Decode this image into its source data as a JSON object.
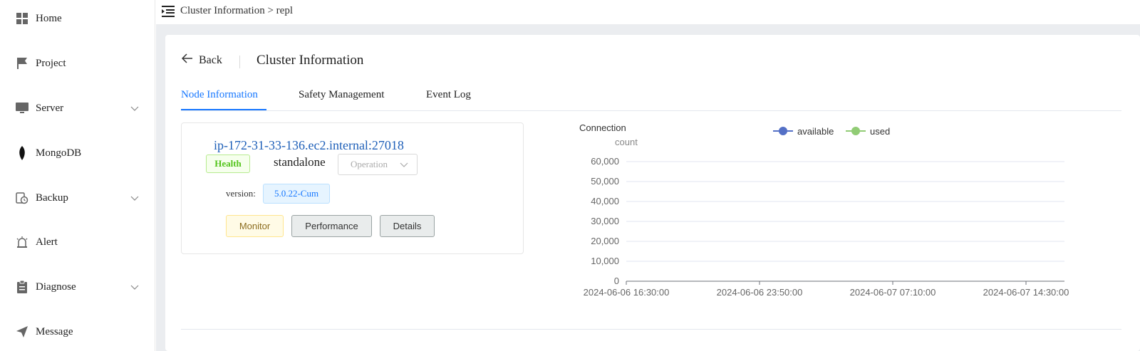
{
  "sidebar": {
    "items": [
      {
        "label": "Home",
        "icon": "grid-icon",
        "has_submenu": false
      },
      {
        "label": "Project",
        "icon": "flag-icon",
        "has_submenu": false
      },
      {
        "label": "Server",
        "icon": "monitor-icon",
        "has_submenu": true
      },
      {
        "label": "MongoDB",
        "icon": "leaf-icon",
        "has_submenu": false
      },
      {
        "label": "Backup",
        "icon": "backup-icon",
        "has_submenu": true
      },
      {
        "label": "Alert",
        "icon": "alarm-icon",
        "has_submenu": false
      },
      {
        "label": "Diagnose",
        "icon": "clipboard-icon",
        "has_submenu": true
      },
      {
        "label": "Message",
        "icon": "send-icon",
        "has_submenu": false
      }
    ]
  },
  "topbar": {
    "breadcrumb": "Cluster Information > repl"
  },
  "header": {
    "back_label": "Back",
    "title": "Cluster Information"
  },
  "tabs": [
    {
      "label": "Node Information",
      "active": true
    },
    {
      "label": "Safety Management",
      "active": false
    },
    {
      "label": "Event Log",
      "active": false
    }
  ],
  "node": {
    "host": "ip-172-31-33-136.ec2.internal:27018",
    "health": "Health",
    "role": "standalone",
    "operation_placeholder": "Operation",
    "version_label": "version:",
    "version": "5.0.22-Cum",
    "buttons": {
      "monitor": "Monitor",
      "performance": "Performance",
      "details": "Details"
    }
  },
  "colors": {
    "accent": "#1677ff",
    "available": "#5470c6",
    "used": "#91cc75",
    "health": "#52c41a"
  },
  "chart_data": {
    "type": "line",
    "title": "Connection",
    "ylabel": "count",
    "xlabel": "",
    "x": [
      "2024-06-06 16:30:00",
      "2024-06-06 23:50:00",
      "2024-06-07 07:10:00",
      "2024-06-07 14:30:00"
    ],
    "ylim": [
      0,
      60000
    ],
    "yticks": [
      "0",
      "10,000",
      "20,000",
      "30,000",
      "40,000",
      "50,000",
      "60,000"
    ],
    "ytick_values": [
      0,
      10000,
      20000,
      30000,
      40000,
      50000,
      60000
    ],
    "series": [
      {
        "name": "available",
        "values": []
      },
      {
        "name": "used",
        "values": []
      }
    ],
    "legend": "top",
    "grid": true
  }
}
